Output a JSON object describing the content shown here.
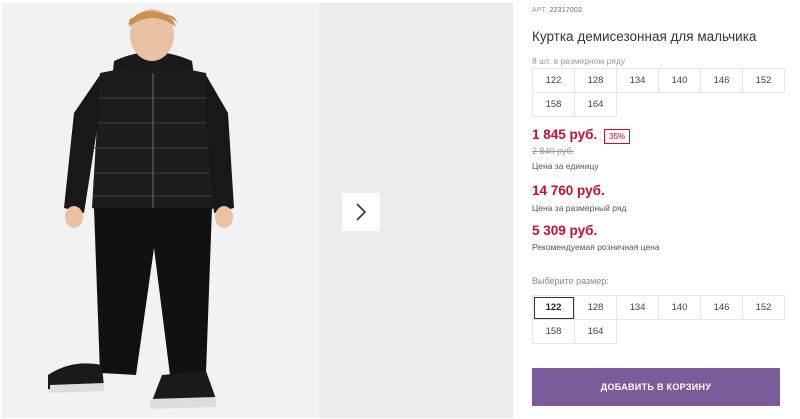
{
  "product": {
    "article_label": "АРТ.",
    "article_number": "22317002",
    "title": "Куртка демисезонная для мальчика",
    "pack_note": "8 шт. в размерном ряду",
    "pack_sizes": [
      "122",
      "128",
      "134",
      "140",
      "146",
      "152",
      "158",
      "164"
    ],
    "price": "1 845 руб.",
    "discount": "35%",
    "old_price": "2 840 руб.",
    "price_unit_label": "Цена за единицу",
    "row_price": "14 760 руб.",
    "row_price_label": "Цена за размерный ряд",
    "rrp": "5 309 руб.",
    "rrp_label": "Рекомендуемая розничная цена",
    "choose_size_label": "Выберите размер:",
    "sizes": [
      "122",
      "128",
      "134",
      "140",
      "146",
      "152",
      "158",
      "164"
    ],
    "selected_size": "122",
    "add_to_cart": "ДОБАВИТЬ В КОРЗИНУ"
  },
  "gallery": {
    "next_icon": "chevron-right-icon"
  },
  "colors": {
    "price": "#c8102e",
    "button": "#7b5c9a",
    "border": "#e6e6e6"
  }
}
